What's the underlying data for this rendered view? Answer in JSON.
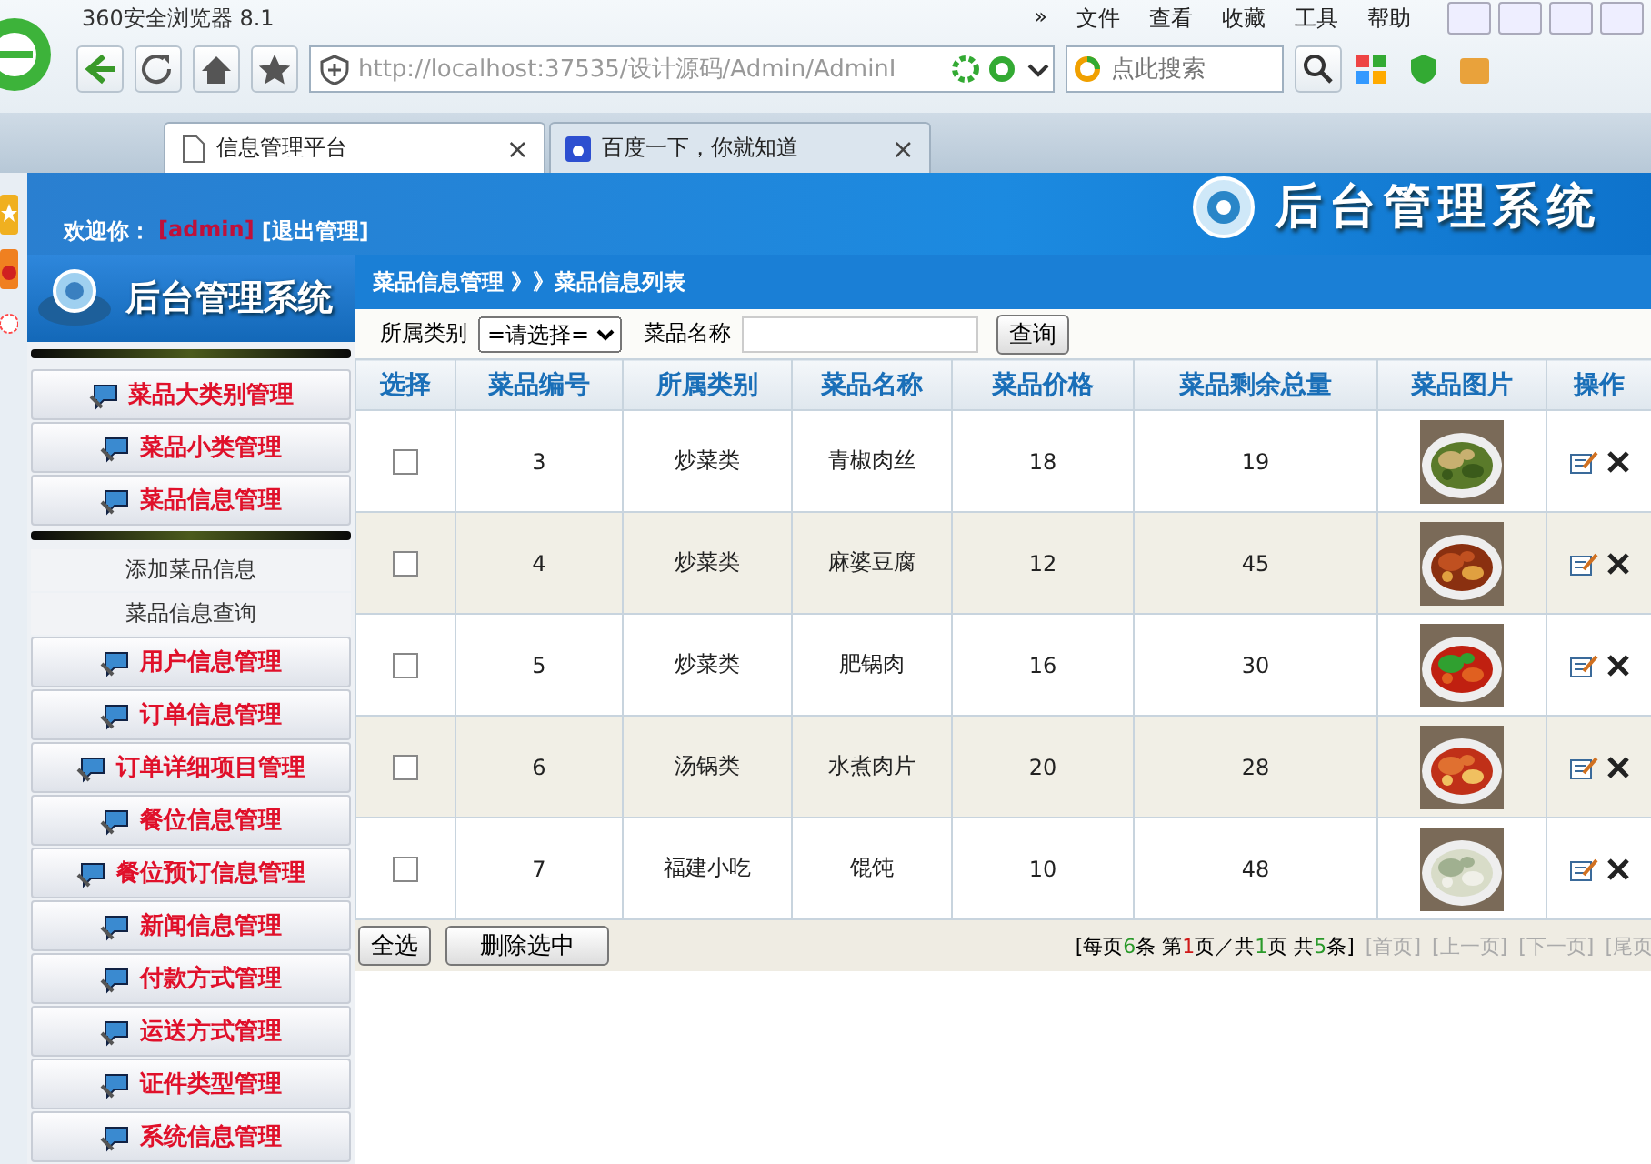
{
  "browser": {
    "title": "360安全浏览器 8.1",
    "menu": [
      "»",
      "文件",
      "查看",
      "收藏",
      "工具",
      "帮助"
    ],
    "address": "http://localhost:37535/设计源码/Admin/AdminI",
    "search": {
      "placeholder": "点此搜索"
    },
    "tabs": [
      {
        "label": "信息管理平台",
        "selected": true,
        "close": "×"
      },
      {
        "label": "百度一下，你就知道",
        "selected": false,
        "close": "×"
      }
    ]
  },
  "header": {
    "welcome": "欢迎你：",
    "user": "[admin]",
    "logout": "[退出管理]",
    "logo": "后台管理系统",
    "banner": "后台管理系统"
  },
  "breadcrumb": "菜品信息管理 》》菜品信息列表",
  "filter": {
    "category_label": "所属类别",
    "category_value": "=请选择=",
    "name_label": "菜品名称",
    "search_button": "查询"
  },
  "sidebar": {
    "items": [
      {
        "label": "菜品大类别管理"
      },
      {
        "label": "菜品小类管理"
      },
      {
        "label": "菜品信息管理",
        "children": [
          {
            "label": "添加菜品信息"
          },
          {
            "label": "菜品信息查询"
          }
        ]
      },
      {
        "label": "用户信息管理"
      },
      {
        "label": "订单信息管理"
      },
      {
        "label": "订单详细项目管理"
      },
      {
        "label": "餐位信息管理"
      },
      {
        "label": "餐位预订信息管理"
      },
      {
        "label": "新闻信息管理"
      },
      {
        "label": "付款方式管理"
      },
      {
        "label": "运送方式管理"
      },
      {
        "label": "证件类型管理"
      },
      {
        "label": "系统信息管理"
      }
    ]
  },
  "table": {
    "columns": [
      "选择",
      "菜品编号",
      "所属类别",
      "菜品名称",
      "菜品价格",
      "菜品剩余总量",
      "菜品图片",
      "操作"
    ],
    "rows": [
      {
        "checked": false,
        "id": "3",
        "category": "炒菜类",
        "name": "青椒肉丝",
        "price": "18",
        "stock": "19"
      },
      {
        "checked": false,
        "id": "4",
        "category": "炒菜类",
        "name": "麻婆豆腐",
        "price": "12",
        "stock": "45"
      },
      {
        "checked": false,
        "id": "5",
        "category": "炒菜类",
        "name": "肥锅肉",
        "price": "16",
        "stock": "30"
      },
      {
        "checked": false,
        "id": "6",
        "category": "汤锅类",
        "name": "水煮肉片",
        "price": "20",
        "stock": "28"
      },
      {
        "checked": false,
        "id": "7",
        "category": "福建小吃",
        "name": "馄饨",
        "price": "10",
        "stock": "48"
      }
    ]
  },
  "actions": [
    "全选",
    "删除选中"
  ],
  "pager": {
    "summary": [
      {
        "text": "[每页",
        "kind": "plain"
      },
      {
        "text": "6",
        "kind": "count"
      },
      {
        "text": "条 第",
        "kind": "plain"
      },
      {
        "text": "1",
        "kind": "page"
      },
      {
        "text": "页／共",
        "kind": "plain"
      },
      {
        "text": "1",
        "kind": "count"
      },
      {
        "text": "页 共",
        "kind": "plain"
      },
      {
        "text": "5",
        "kind": "count"
      },
      {
        "text": "条]",
        "kind": "plain"
      }
    ],
    "links": [
      {
        "label": "[首页]",
        "disabled": true
      },
      {
        "label": "[上一页]",
        "disabled": true
      },
      {
        "label": "[下一页]",
        "disabled": true
      },
      {
        "label": "[尾页",
        "disabled": true
      }
    ]
  }
}
